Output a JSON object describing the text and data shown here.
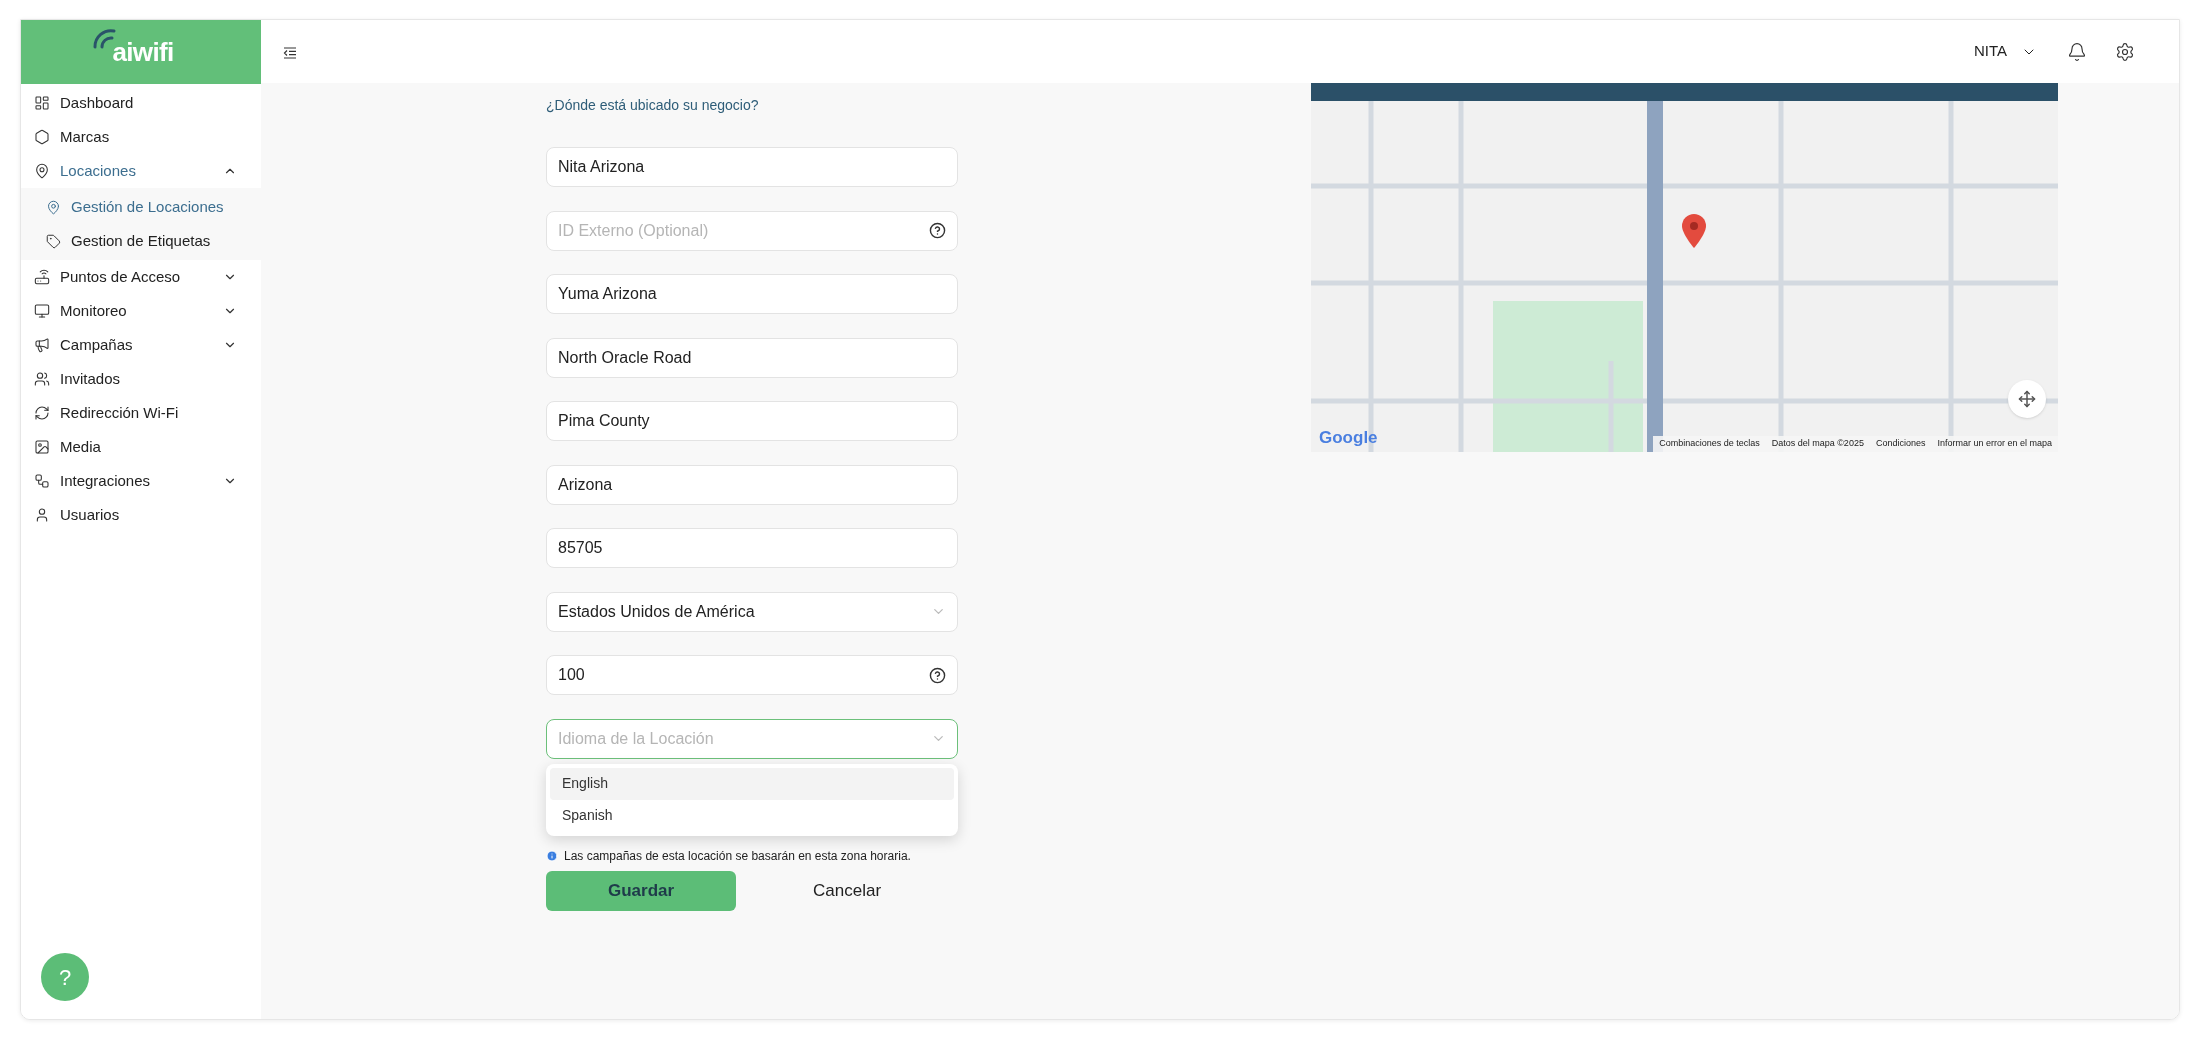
{
  "header": {
    "user": "NITA"
  },
  "sidebar": {
    "logo": "aiwifi",
    "items": [
      {
        "label": "Dashboard",
        "selected": false
      },
      {
        "label": "Marcas",
        "selected": false
      },
      {
        "label": "Locaciones",
        "selected": true,
        "expanded": true,
        "children": [
          {
            "label": "Gestión de Locaciones",
            "selected": true
          },
          {
            "label": "Gestion de Etiquetas",
            "selected": false
          }
        ]
      },
      {
        "label": "Puntos de Acceso",
        "selected": false,
        "expanded": false
      },
      {
        "label": "Monitoreo",
        "selected": false,
        "expanded": false
      },
      {
        "label": "Campañas",
        "selected": false,
        "expanded": false
      },
      {
        "label": "Invitados",
        "selected": false
      },
      {
        "label": "Redirección Wi-Fi",
        "selected": false
      },
      {
        "label": "Media",
        "selected": false
      },
      {
        "label": "Integraciones",
        "selected": false,
        "expanded": false
      },
      {
        "label": "Usuarios",
        "selected": false
      }
    ],
    "help_button": "?"
  },
  "form": {
    "question": "¿Dónde está ubicado su negocio?",
    "fields": [
      {
        "kind": "text",
        "value": "Nita Arizona"
      },
      {
        "kind": "text",
        "placeholder": "ID Externo (Optional)",
        "help": true
      },
      {
        "kind": "text",
        "value": "Yuma Arizona"
      },
      {
        "kind": "text",
        "value": "North Oracle Road"
      },
      {
        "kind": "text",
        "value": "Pima County"
      },
      {
        "kind": "text",
        "value": "Arizona"
      },
      {
        "kind": "text",
        "value": "85705"
      },
      {
        "kind": "select",
        "value": "Estados Unidos de América",
        "open": false
      },
      {
        "kind": "text",
        "value": "100",
        "help": true
      },
      {
        "kind": "select",
        "placeholder": "Idioma de la Locación",
        "open": true,
        "options": [
          {
            "label": "English",
            "selected": true
          },
          {
            "label": "Spanish",
            "selected": false
          }
        ]
      }
    ],
    "note": "Las campañas de esta locación se basarán en esta zona horaria.",
    "save": "Guardar",
    "cancel": "Cancelar"
  },
  "map": {
    "logo": "Google",
    "attribution": [
      "Combinaciones de teclas",
      "Datos del mapa ©2025",
      "Condiciones",
      "Informar un error en el mapa"
    ]
  }
}
